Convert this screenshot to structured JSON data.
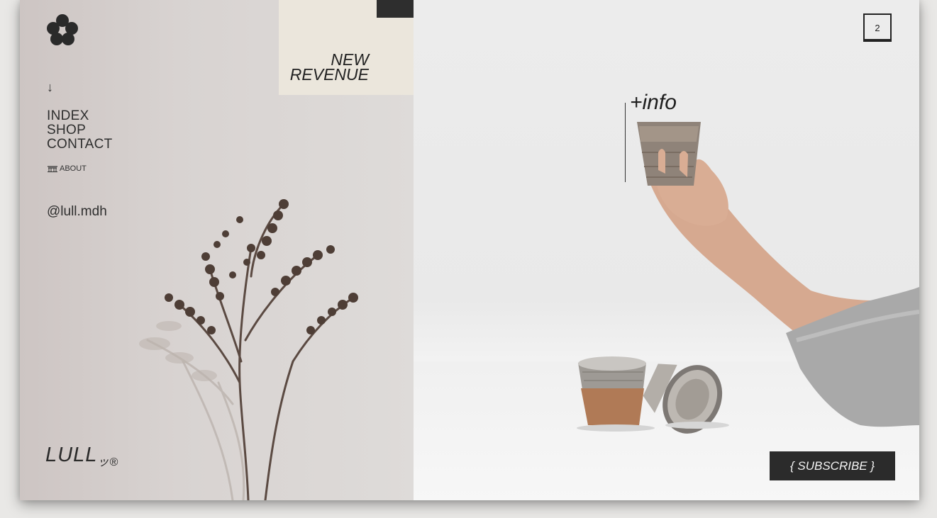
{
  "nav": {
    "down_arrow": "↓",
    "items": [
      "INDEX",
      "SHOP",
      "CONTACT"
    ],
    "about": "ABOUT",
    "handle": "@lull.mdh"
  },
  "brand": {
    "name": "LULL",
    "suffix": "ッ®"
  },
  "feature": {
    "line1": "NEW",
    "line2": "REVENUE"
  },
  "hero": {
    "page_number": "2",
    "info_label": "+info",
    "subscribe_label": "{ SUBSCRIBE }"
  },
  "colors": {
    "left_panel": "#d8d3d1",
    "right_panel": "#ececec",
    "revenue_box": "#ebe6dc",
    "dark_accent": "#2b2b2b"
  },
  "icons": {
    "logo": "flower-icon",
    "about": "temple-icon",
    "arrow": "arrow-down-icon"
  }
}
